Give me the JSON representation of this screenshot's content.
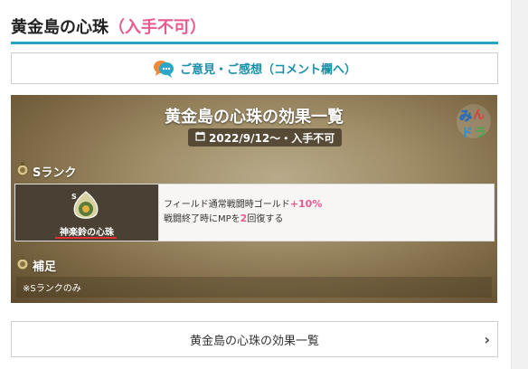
{
  "header": {
    "title": "黄金島の心珠",
    "title_suffix": "（入手不可）"
  },
  "opinion_button": {
    "label": "ご意見・ご感想（コメント欄へ）",
    "icon": "chat-bubbles-icon"
  },
  "card": {
    "title": "黄金島の心珠の効果一覧",
    "date": "2022/9/12〜・入手不可",
    "logo_text": "みんドラ",
    "rank_section": {
      "label": "Sランク"
    },
    "item": {
      "name": "神楽鈴の心珠",
      "effect_line1_prefix": "フィールド通常戦闘時ゴールド",
      "effect_line1_value": "+10%",
      "effect_line2_prefix": "戦闘終了時にMPを",
      "effect_line2_value": "2",
      "effect_line2_suffix": "回復する"
    },
    "note_section": {
      "label": "補足",
      "text": "※Sランクのみ"
    }
  },
  "link_button": {
    "label": "黄金島の心珠の効果一覧"
  },
  "colors": {
    "accent_teal": "#28a4be",
    "pink": "#e8598f",
    "link_blue": "#1b8fa8"
  }
}
